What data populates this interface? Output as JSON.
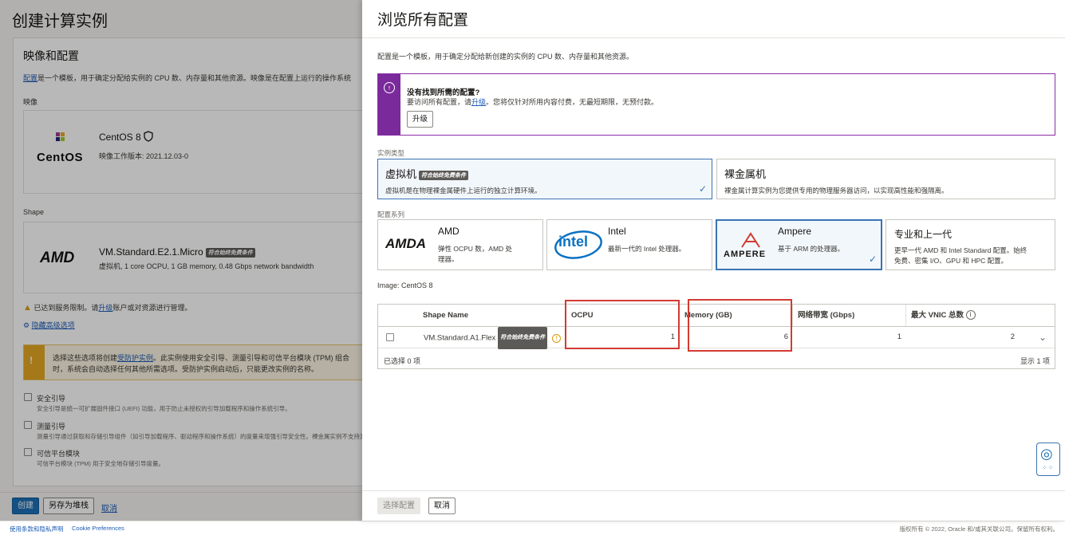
{
  "left": {
    "page_title": "创建计算实例",
    "section_title": "映像和配置",
    "intro_link": "配置",
    "intro_text": "是一个模板，用于确定分配给实例的 CPU 数、内存量和其他资源。映像是在配置上运行的操作系统",
    "image_label": "映像",
    "image_logo": "CentOS",
    "image_name": "CentOS 8",
    "image_build": "映像工作版本: 2021.12.03-0",
    "shape_label": "Shape",
    "shape_logo": "AMD",
    "shape_name": "VM.Standard.E2.1.Micro",
    "shape_badge": "符合始终免费条件",
    "shape_desc": "虚拟机, 1 core OCPU, 1 GB memory, 0.48 Gbps network bandwidth",
    "limit_prefix": "已达到服务限制。请",
    "limit_link": "升级",
    "limit_suffix": "账户或对资源进行管理。",
    "advanced_link": "隐藏高级选项",
    "warn_line1_a": "选择这些选项将创建",
    "warn_line1_link": "受防护实例",
    "warn_line1_b": "。此实例使用安全引导、测量引导和可信平台模块 (TPM) 组合",
    "warn_line2": "时，系统会自动选择任何其他所需选项。受防护实例启动后，只能更改实例的名称。",
    "options": [
      {
        "title": "安全引导",
        "desc": "安全引导是统一可扩展固件接口 (UEFI) 功能，用于防止未授权的引导加载程序和操作系统引导。"
      },
      {
        "title": "测量引导",
        "desc": "测量引导通过获取和存储引导组件（如引导加载程序、驱动程序和操作系统）的度量来增强引导安全性。裸金属实例不支持测量"
      },
      {
        "title": "可信平台模块",
        "desc": "可信平台模块 (TPM) 用于安全地存储引导度量。"
      }
    ],
    "btn_create": "创建",
    "btn_save_stack": "另存为堆栈",
    "btn_cancel": "取消"
  },
  "footer": {
    "terms": "使用条款和隐私声明",
    "cookie": "Cookie Preferences",
    "copyright": "版权所有 © 2022, Oracle 和/或其关联公司。保留所有权利。"
  },
  "panel": {
    "title": "浏览所有配置",
    "intro": "配置是一个模板，用于确定分配给新创建的实例的 CPU 数、内存量和其他资源。",
    "info_title": "没有找到所需的配置?",
    "info_text_a": "要访问所有配置，请",
    "info_link": "升级",
    "info_text_b": "。您将仅针对所用内容付费，无最短期限，无预付款。",
    "info_button": "升级",
    "instance_type_label": "实例类型",
    "vm_title": "虚拟机",
    "vm_badge": "符合始终免费条件",
    "vm_desc": "虚拟机是在物理裸金属硬件上运行的独立计算环境。",
    "bm_title": "裸金属机",
    "bm_desc": "裸金属计算实例为您提供专用的物理服务器访问，以实现高性能和强隔离。",
    "series_label": "配置系列",
    "families": [
      {
        "logo": "AMDA",
        "title": "AMD",
        "desc1": "弹性 OCPU 数，AMD 处",
        "desc2": "理器。"
      },
      {
        "logo": "intel",
        "title": "Intel",
        "desc1": "最新一代的 Intel 处理器。",
        "desc2": ""
      },
      {
        "logo": "AMPERE",
        "title": "Ampere",
        "desc1": "基于 ARM 的处理器。",
        "desc2": ""
      },
      {
        "logo": "",
        "title": "专业和上一代",
        "desc1": "更早一代 AMD 和 Intel Standard 配置。始终",
        "desc2": "免费、密集 I/O、GPU 和 HPC 配置。"
      }
    ],
    "image_line": "Image: CentOS 8",
    "table": {
      "headers": [
        "Shape Name",
        "OCPU",
        "Memory (GB)",
        "网络带宽 (Gbps)",
        "最大 VNIC 总数"
      ],
      "row": {
        "name": "VM.Standard.A1.Flex",
        "badge": "符合始终免费条件",
        "ocpu": "1",
        "memory": "6",
        "bandwidth": "1",
        "vnic": "2"
      },
      "selected_count": "已选择 0 项",
      "shown_count": "显示 1 项"
    },
    "btn_select": "选择配置",
    "btn_cancel": "取消"
  }
}
